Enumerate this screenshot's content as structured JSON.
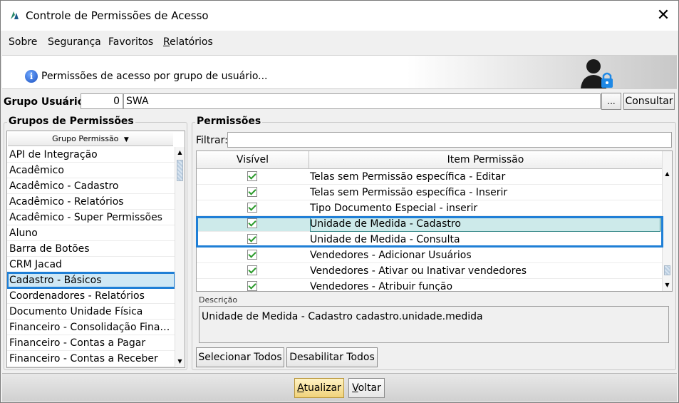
{
  "window": {
    "title": "Controle de Permissões de Acesso",
    "close_glyph": "✕",
    "app_icon": "app-logo-icon"
  },
  "menu": {
    "items": [
      "Sobre",
      "Segurança",
      "Favoritos",
      "Relatórios"
    ]
  },
  "banner": {
    "text": "Permissões de acesso por grupo de usuário...",
    "info_glyph": "i"
  },
  "group": {
    "label": "Grupo Usuário:",
    "code": "0",
    "name": "SWA",
    "ellipsis_label": "...",
    "consultar_label": "Consultar"
  },
  "left_panel": {
    "title": "Grupos de Permissões",
    "column_header": "Grupo Permissão",
    "sort_glyph": "▼",
    "items": [
      "API de Integração",
      "Acadêmico",
      "Acadêmico - Cadastro",
      "Acadêmico - Relatórios",
      "Acadêmico - Super Permissões",
      "Aluno",
      "Barra de Botões",
      "CRM Jacad",
      "Cadastro - Básicos",
      "Coordenadores - Relatórios",
      "Documento Unidade Física",
      "Financeiro - Consolidação Financ...",
      "Financeiro - Contas a Pagar",
      "Financeiro - Contas a Receber"
    ],
    "selected_item": "Cadastro - Básicos"
  },
  "right_panel": {
    "title": "Permissões",
    "filter_label": "Filtrar:",
    "filter_value": "",
    "columns": [
      "Visível",
      "Item Permissão"
    ],
    "rows": [
      {
        "visible": true,
        "item": "Telas sem Permissão específica - Editar"
      },
      {
        "visible": true,
        "item": "Telas sem Permissão específica - Inserir"
      },
      {
        "visible": true,
        "item": "Tipo Documento Especial - inserir"
      },
      {
        "visible": true,
        "item": "Unidade de Medida - Cadastro"
      },
      {
        "visible": true,
        "item": "Unidade de Medida - Consulta"
      },
      {
        "visible": true,
        "item": "Vendedores - Adicionar Usuários"
      },
      {
        "visible": true,
        "item": "Vendedores - Ativar ou Inativar vendedores"
      },
      {
        "visible": true,
        "item": "Vendedores - Atribuir função"
      }
    ],
    "highlighted_row": "Unidade de Medida - Cadastro",
    "description_label": "Descrição",
    "description": "Unidade de Medida - Cadastro cadastro.unidade.medida",
    "select_all_label": "Selecionar Todos",
    "disable_all_label": "Desabilitar Todos"
  },
  "footer": {
    "atualizar_label": "Atualizar",
    "voltar_label": "Voltar"
  },
  "colors": {
    "selection_frame": "#1f7fd6",
    "row_highlight": "#cdeaea",
    "check_color": "#2a9a2a",
    "primary_button": "#f0d27a"
  }
}
